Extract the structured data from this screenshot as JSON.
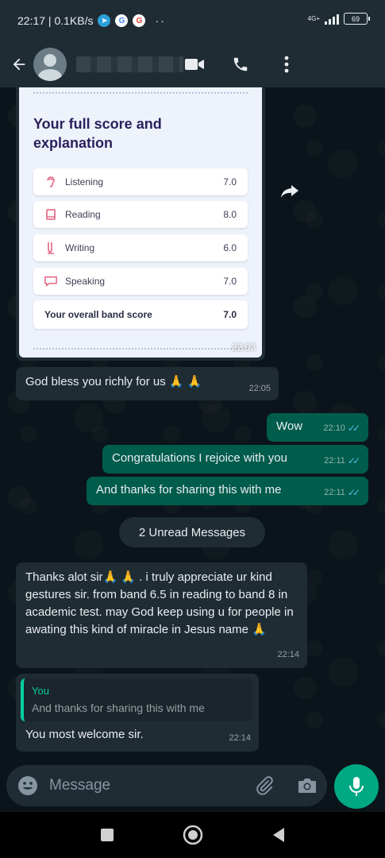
{
  "status_bar": {
    "time_speed": "22:17 | 0.1KB/s",
    "dots": "··",
    "network": "4G+",
    "battery": "69"
  },
  "header": {
    "contact_name": "",
    "icons": [
      "back-arrow-icon",
      "video-call-icon",
      "voice-call-icon",
      "more-vert-icon"
    ]
  },
  "score_card": {
    "title": "Your full score and explanation",
    "rows": [
      {
        "label": "Listening",
        "value": "7.0",
        "icon": "ear-icon"
      },
      {
        "label": "Reading",
        "value": "8.0",
        "icon": "book-icon"
      },
      {
        "label": "Writing",
        "value": "6.0",
        "icon": "pen-icon"
      },
      {
        "label": "Speaking",
        "value": "7.0",
        "icon": "speech-icon"
      }
    ],
    "overall_label": "Your overall band score",
    "overall_value": "7.0",
    "time": "22:03"
  },
  "messages": [
    {
      "direction": "in",
      "text": "God bless you richly for us 🙏 🙏",
      "time": "22:05"
    },
    {
      "direction": "out",
      "text": "Wow",
      "time": "22:10"
    },
    {
      "direction": "out",
      "text": "Congratulations I rejoice with you",
      "time": "22:11"
    },
    {
      "direction": "out",
      "text": "And thanks for sharing this with me",
      "time": "22:11"
    },
    {
      "direction": "in",
      "text": "Thanks alot sir🙏 🙏 . i truly appreciate ur kind gestures sir. from band 6.5 in reading to band 8 in academic test. may God keep using u for people in awating this kind of miracle in Jesus name 🙏",
      "time": "22:14"
    },
    {
      "direction": "in",
      "quote_name": "You",
      "quote_text": "And thanks for sharing this with me",
      "text": "You most welcome sir.",
      "time": "22:14"
    }
  ],
  "unread_label": "2 Unread Messages",
  "input": {
    "placeholder": "Message"
  },
  "colors": {
    "header_bg": "#1f2c34",
    "chat_bg": "#0b141a",
    "incoming_bubble": "#1f2c34",
    "outgoing_bubble": "#005c4b",
    "accent": "#00a884",
    "read_ticks": "#53bdeb"
  }
}
